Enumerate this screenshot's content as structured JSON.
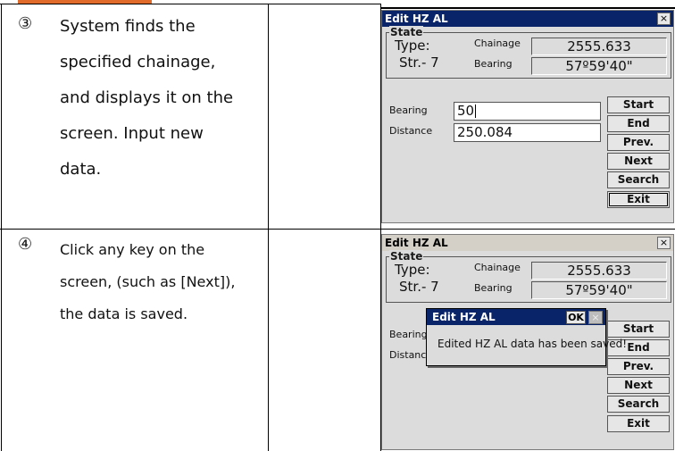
{
  "steps": [
    {
      "number": "③",
      "lines": [
        "System finds the",
        "specified chainage,",
        "and displays it on the",
        "screen. Input new",
        "data."
      ]
    },
    {
      "number": "④",
      "lines": [
        "Click any key on the",
        "screen, (such as [Next]),",
        "the data is saved."
      ]
    }
  ],
  "window1": {
    "title": "Edit HZ AL",
    "close_label": "×",
    "state": {
      "label": "State",
      "type_label": "Type:",
      "str_label": "Str.- 7",
      "chainage_label": "Chainage",
      "chainage_value": "2555.633",
      "bearing_label": "Bearing",
      "bearing_value": "57º59'40\""
    },
    "bearing_input_label": "Bearing",
    "bearing_input_value": "50",
    "distance_label": "Distance",
    "distance_value": "250.084",
    "buttons": [
      "Start",
      "End",
      "Prev.",
      "Next",
      "Search",
      "Exit"
    ]
  },
  "window2": {
    "title": "Edit HZ AL",
    "close_label": "×",
    "state": {
      "label": "State",
      "type_label": "Type:",
      "str_label": "Str.- 7",
      "chainage_label": "Chainage",
      "chainage_value": "2555.633",
      "bearing_label": "Bearing",
      "bearing_value": "57º59'40\""
    },
    "bearing_input_label": "Bearing",
    "distance_label": "Distance",
    "buttons": [
      "Start",
      "End",
      "Prev.",
      "Next",
      "Search",
      "Exit"
    ],
    "message": {
      "title": "Edit HZ AL",
      "ok_label": "OK",
      "close_label": "×",
      "text": "Edited HZ AL data has been saved!"
    }
  }
}
